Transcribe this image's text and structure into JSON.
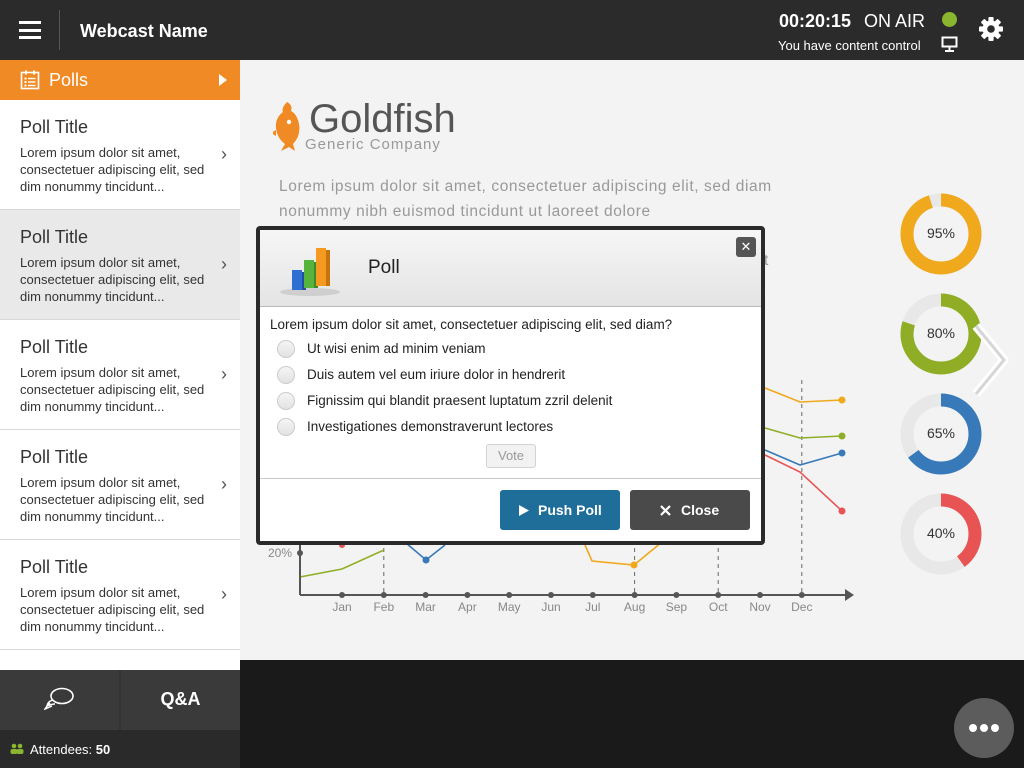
{
  "header": {
    "webcast_name": "Webcast Name",
    "timer": "00:20:15",
    "status": "ON AIR",
    "control_text": "You have content control"
  },
  "sidebar": {
    "title": "Polls",
    "items": [
      {
        "title": "Poll Title",
        "description": "Lorem ipsum dolor sit amet, consectetuer adipiscing elit, sed dim nonummy tincidunt..."
      },
      {
        "title": "Poll Title",
        "description": "Lorem ipsum dolor sit amet, consectetuer adipiscing elit, sed dim nonummy tincidunt..."
      },
      {
        "title": "Poll Title",
        "description": "Lorem ipsum dolor sit amet, consectetuer adipiscing elit, sed dim nonummy tincidunt..."
      },
      {
        "title": "Poll Title",
        "description": "Lorem ipsum dolor sit amet, consectetuer adipiscing elit, sed dim nonummy tincidunt..."
      },
      {
        "title": "Poll Title",
        "description": "Lorem ipsum dolor sit amet, consectetuer adipiscing elit, sed dim nonummy tincidunt..."
      }
    ],
    "active_index": 1,
    "qa_label": "Q&A",
    "attendees_label": "Attendees:",
    "attendees_count": "50"
  },
  "slide": {
    "brand": "Goldfish",
    "brand_sub": "Generic Company",
    "text": "Lorem ipsum dolor sit amet, consectetuer adipiscing elit, sed diam nonummy nibh euismod tincidunt ut laoreet dolore",
    "text_fragment": "t",
    "donuts": [
      {
        "label": "95%",
        "value": 95,
        "color": "#f0a81c"
      },
      {
        "label": "80%",
        "value": 80,
        "color": "#8fae26"
      },
      {
        "label": "65%",
        "value": 65,
        "color": "#3879ba"
      },
      {
        "label": "40%",
        "value": 40,
        "color": "#e85454"
      }
    ]
  },
  "chart_data": {
    "type": "line",
    "categories": [
      "Jan",
      "Feb",
      "Mar",
      "Apr",
      "May",
      "Jun",
      "Jul",
      "Aug",
      "Sep",
      "Oct",
      "Nov",
      "Dec"
    ],
    "visible_ytick": "20%",
    "series": [
      {
        "color": "#f0a81c"
      },
      {
        "color": "#8fae26"
      },
      {
        "color": "#3879ba"
      },
      {
        "color": "#e85454"
      }
    ]
  },
  "poll_dialog": {
    "title": "Poll",
    "question": "Lorem ipsum dolor sit amet, consectetuer adipiscing elit, sed diam?",
    "options": [
      "Ut wisi enim ad minim veniam",
      "Duis autem vel eum iriure dolor in hendrerit",
      "Fignissim qui blandit praesent luptatum zzril delenit",
      "Investigationes demonstraverunt lectores"
    ],
    "vote_label": "Vote",
    "push_label": "Push Poll",
    "close_label": "Close"
  }
}
